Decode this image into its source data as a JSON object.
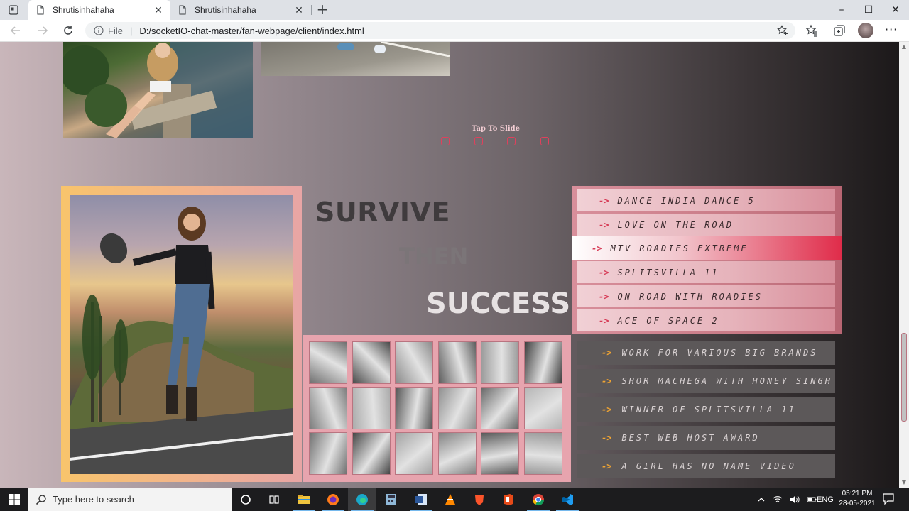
{
  "browser": {
    "tabs": [
      {
        "title": "Shrutisinhahaha",
        "close": "✕"
      },
      {
        "title": "Shrutisinhahaha",
        "close": "✕"
      }
    ],
    "new_tab": "+",
    "window": {
      "minimize": "–",
      "maximize": "☐",
      "close": "✕"
    },
    "address": {
      "scheme": "File",
      "separator": "|",
      "url": "D:/socketIO-chat-master/fan-webpage/client/index.html"
    },
    "more": "···"
  },
  "page": {
    "tap_to_slide": "Tap To Slide",
    "slider_dots": 4,
    "headline": {
      "word1": "SURVIVE",
      "word2": "THEN",
      "word3": "SUCCESS"
    },
    "shows": [
      {
        "label": "DANCE INDIA DANCE 5",
        "active": false
      },
      {
        "label": "LOVE ON THE ROAD",
        "active": false
      },
      {
        "label": "MTV ROADIES EXTREME",
        "active": true
      },
      {
        "label": "SPLITSVILLA 11",
        "active": false
      },
      {
        "label": "ON ROAD WITH ROADIES",
        "active": false
      },
      {
        "label": "ACE OF SPACE 2",
        "active": false
      }
    ],
    "achievements": [
      "WORK FOR VARIOUS BIG BRANDS",
      "SHOR MACHEGA WITH HONEY SINGH",
      "WINNER OF SPLITSVILLA 11",
      "BEST WEB HOST AWARD",
      "A GIRL HAS NO NAME VIDEO"
    ],
    "arrow_glyph": "->",
    "colors": {
      "accent_red": "#e02c4a",
      "achievement_arrow": "#f1a532",
      "frame_gold": "#f8c46c"
    }
  },
  "taskbar": {
    "search_placeholder": "Type here to search",
    "language": "ENG",
    "time": "05:21 PM",
    "date": "28-05-2021",
    "apps": [
      "cortana-icon",
      "task-view-icon",
      "file-explorer-icon",
      "firefox-icon",
      "edge-icon",
      "calculator-icon",
      "word-icon",
      "vlc-icon",
      "brave-icon",
      "office-icon",
      "chrome-icon",
      "vscode-icon"
    ]
  }
}
